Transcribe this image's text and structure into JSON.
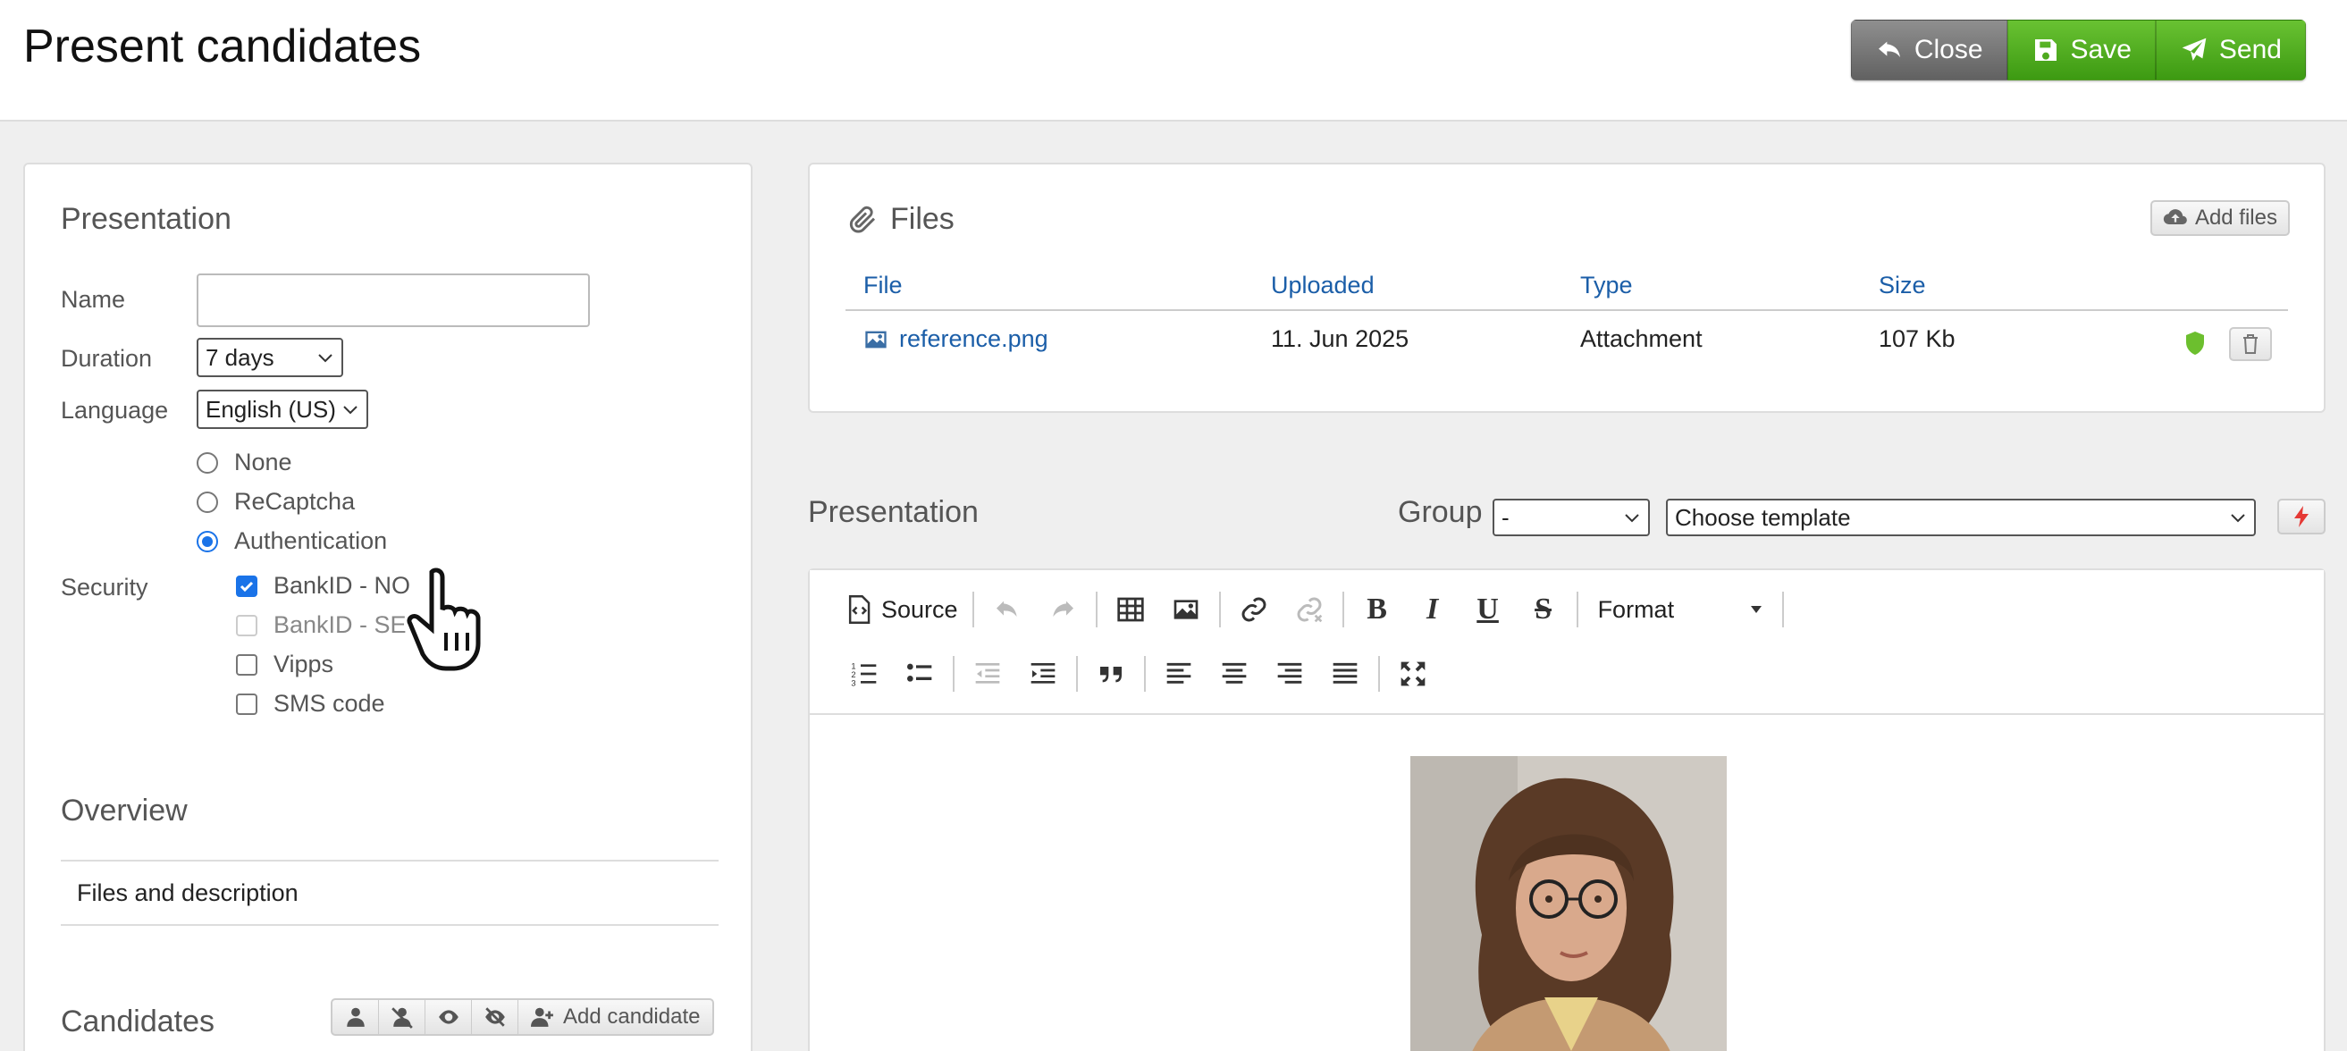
{
  "header": {
    "title": "Present candidates",
    "close_label": "Close",
    "save_label": "Save",
    "send_label": "Send"
  },
  "presentation_form": {
    "title": "Presentation",
    "name_label": "Name",
    "name_value": "",
    "duration_label": "Duration",
    "duration_value": "7 days",
    "language_label": "Language",
    "language_value": "English (US)",
    "security_label": "Security",
    "radios": [
      {
        "label": "None",
        "checked": false
      },
      {
        "label": "ReCaptcha",
        "checked": false
      },
      {
        "label": "Authentication",
        "checked": true
      }
    ],
    "checkboxes": [
      {
        "label": "BankID - NO",
        "checked": true,
        "disabled": false
      },
      {
        "label": "BankID - SE",
        "checked": false,
        "disabled": true
      },
      {
        "label": "Vipps",
        "checked": false,
        "disabled": false
      },
      {
        "label": "SMS code",
        "checked": false,
        "disabled": false
      }
    ]
  },
  "overview": {
    "title": "Overview",
    "items": [
      "Files and description"
    ]
  },
  "candidates": {
    "title": "Candidates",
    "add_label": "Add candidate"
  },
  "files": {
    "title": "Files",
    "add_label": "Add files",
    "columns": [
      "File",
      "Uploaded",
      "Type",
      "Size"
    ],
    "rows": [
      {
        "file": "reference.png",
        "uploaded": "11. Jun 2025",
        "type": "Attachment",
        "size": "107 Kb"
      }
    ]
  },
  "editor": {
    "title": "Presentation",
    "group_label": "Group",
    "group_value": "-",
    "template_value": "Choose template",
    "source_label": "Source",
    "format_label": "Format"
  },
  "colors": {
    "accent_blue": "#1b5ea8",
    "send_green": "#4caf23",
    "close_gray": "#777777",
    "shield_green": "#6cbf2e"
  }
}
